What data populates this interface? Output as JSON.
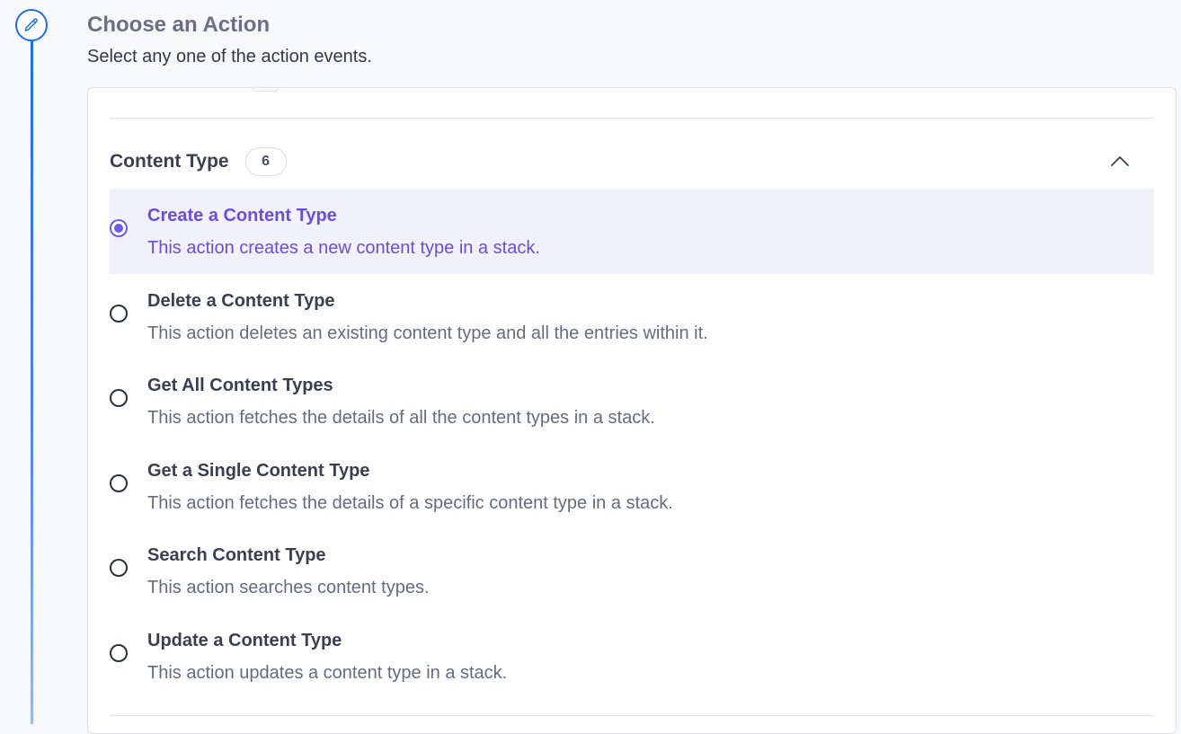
{
  "header": {
    "title": "Choose an Action",
    "subtitle": "Select any one of the action events."
  },
  "step_icon": "pencil-icon",
  "group": {
    "title": "Content Type",
    "count": "6",
    "expanded": true,
    "toggle_icon": "chevron-up-icon"
  },
  "options": [
    {
      "title": "Create a Content Type",
      "description": "This action creates a new content type in a stack.",
      "selected": true
    },
    {
      "title": "Delete a Content Type",
      "description": "This action deletes an existing content type and all the entries within it.",
      "selected": false
    },
    {
      "title": "Get All Content Types",
      "description": "This action fetches the details of all the content types in a stack.",
      "selected": false
    },
    {
      "title": "Get a Single Content Type",
      "description": "This action fetches the details of a specific content type in a stack.",
      "selected": false
    },
    {
      "title": "Search Content Type",
      "description": "This action searches content types.",
      "selected": false
    },
    {
      "title": "Update a Content Type",
      "description": "This action updates a content type in a stack.",
      "selected": false
    }
  ],
  "colors": {
    "accent": "#6c5ce7",
    "step_blue": "#1f6fe0",
    "selected_bg": "#f0f1fb"
  }
}
